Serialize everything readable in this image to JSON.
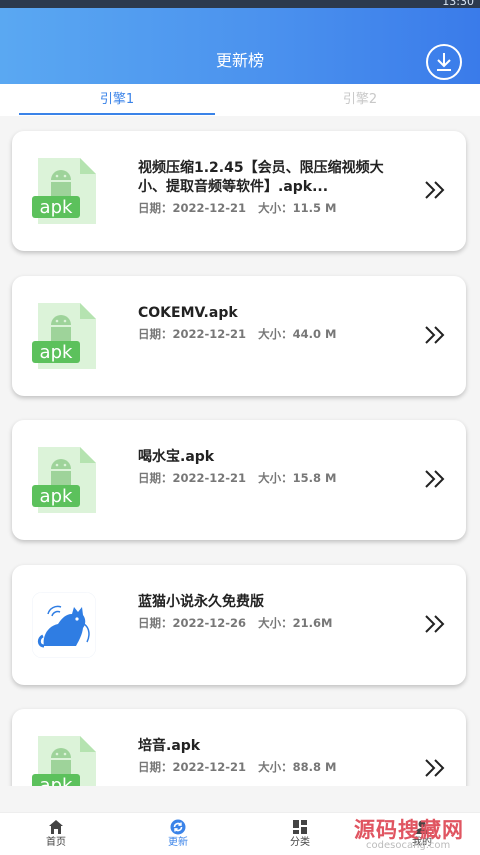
{
  "status_bar": {
    "time": "13:30"
  },
  "header": {
    "title": "更新榜",
    "download_icon": "download-circle-icon"
  },
  "tabs": [
    {
      "label": "引擎1",
      "active": true
    },
    {
      "label": "引擎2",
      "active": false
    }
  ],
  "date_prefix": "日期：",
  "size_prefix": "大小：",
  "items": [
    {
      "name": "视频压缩1.2.45【会员、限压缩视频大小、提取音频等软件】.apk...",
      "date": "2022-12-21",
      "size": "11.5 M",
      "icon": "apk",
      "icon_text": "apk"
    },
    {
      "name": "COKEMV.apk",
      "date": "2022-12-21",
      "size": "44.0 M",
      "icon": "apk",
      "icon_text": "apk"
    },
    {
      "name": "喝水宝.apk",
      "date": "2022-12-21",
      "size": "15.8 M",
      "icon": "apk",
      "icon_text": "apk"
    },
    {
      "name": "蓝猫小说永久免费版",
      "date": "2022-12-26",
      "size": "21.6M",
      "icon": "cat",
      "icon_text": ""
    },
    {
      "name": "培音.apk",
      "date": "2022-12-21",
      "size": "88.8 M",
      "icon": "apk",
      "icon_text": "apk"
    }
  ],
  "bottom_nav": [
    {
      "label": "首页",
      "icon": "home-icon",
      "active": false
    },
    {
      "label": "更新",
      "icon": "refresh-icon",
      "active": true
    },
    {
      "label": "分类",
      "icon": "category-icon",
      "active": false
    },
    {
      "label": "我的",
      "icon": "user-icon",
      "active": false
    }
  ],
  "colors": {
    "accent": "#3a83e8",
    "header_start": "#5aa8f2",
    "header_end": "#3a7bea",
    "apk_green": "#5cc15c",
    "apk_bg": "#dcf3d9"
  },
  "watermark": {
    "title": "源码搜藏网",
    "domain": "codesocang.com"
  }
}
